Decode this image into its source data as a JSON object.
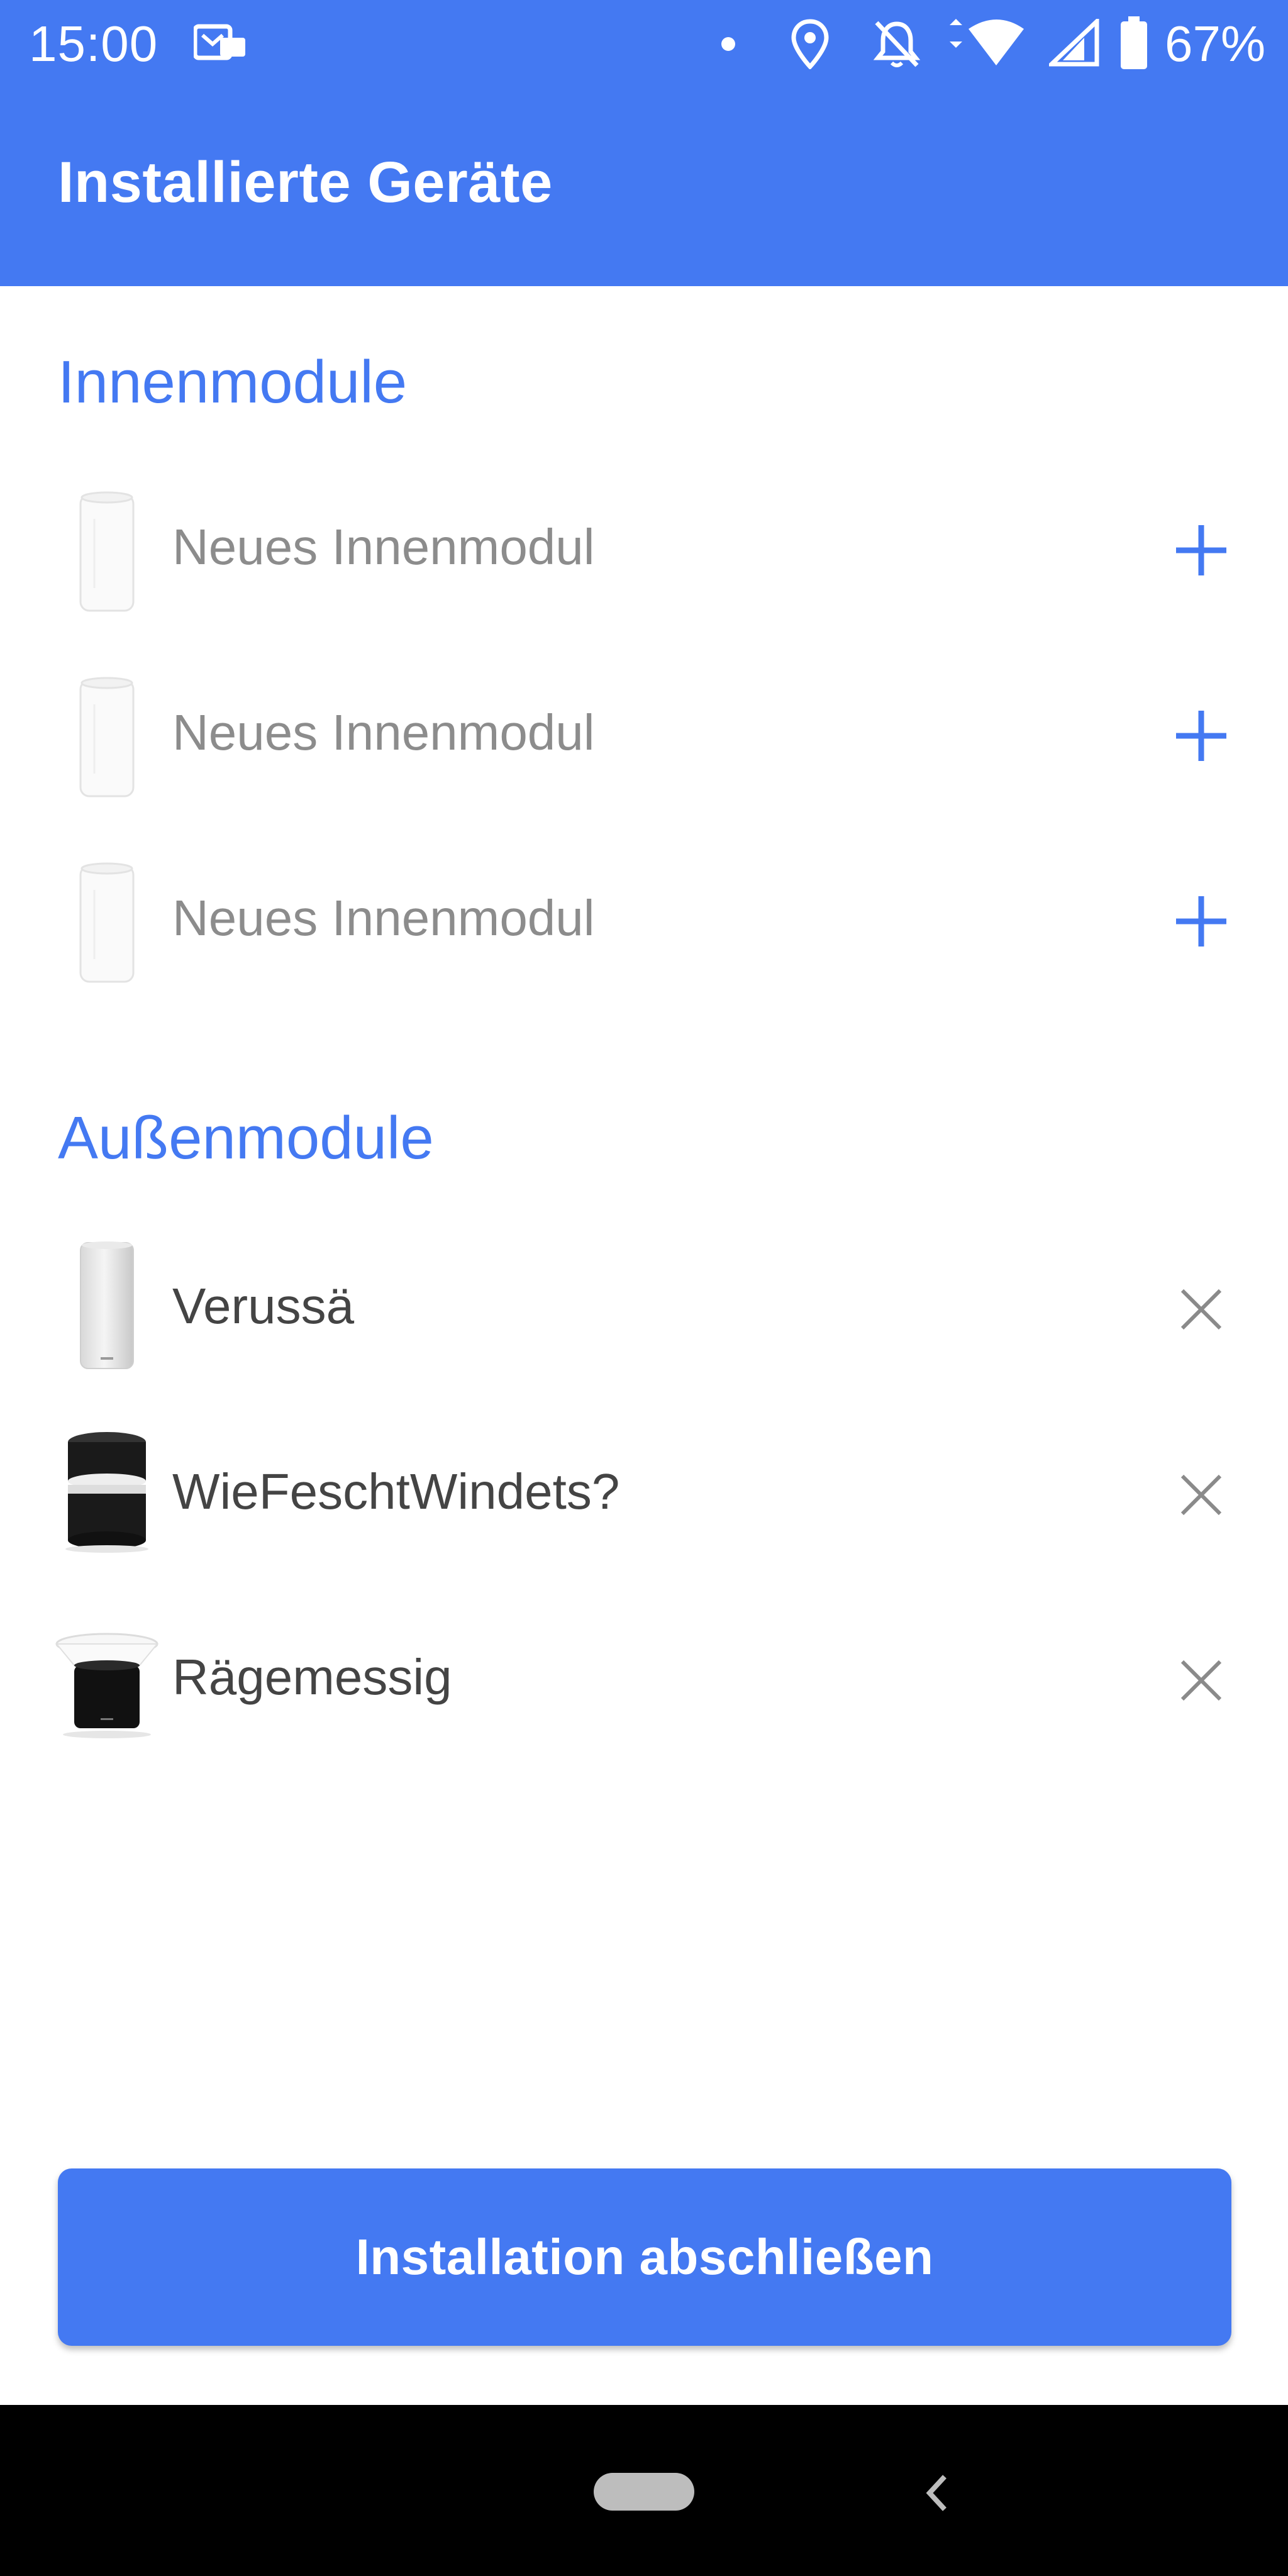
{
  "status_bar": {
    "time": "15:00",
    "battery_percent": "67%",
    "icons": [
      "message-notification-icon",
      "dot-icon",
      "location-icon",
      "alarm-off-icon",
      "wifi-icon",
      "signal-icon",
      "battery-icon"
    ]
  },
  "header": {
    "title": "Installierte Geräte"
  },
  "sections": {
    "indoor": {
      "title": "Innenmodule",
      "items": [
        {
          "label": "Neues Innenmodul",
          "action": "add-icon"
        },
        {
          "label": "Neues Innenmodul",
          "action": "add-icon"
        },
        {
          "label": "Neues Innenmodul",
          "action": "add-icon"
        }
      ]
    },
    "outdoor": {
      "title": "Außenmodule",
      "items": [
        {
          "label": "Verussä",
          "icon": "outdoor-module-icon",
          "action": "remove-icon"
        },
        {
          "label": "WieFeschtWindets?",
          "icon": "wind-gauge-icon",
          "action": "remove-icon"
        },
        {
          "label": "Rägemessig",
          "icon": "rain-gauge-icon",
          "action": "remove-icon"
        }
      ]
    }
  },
  "footer": {
    "finish_label": "Installation abschließen"
  },
  "colors": {
    "accent": "#4479f2",
    "muted_text": "#8c8c8c",
    "text": "#444444",
    "icon_gray": "#8a8a8a"
  }
}
